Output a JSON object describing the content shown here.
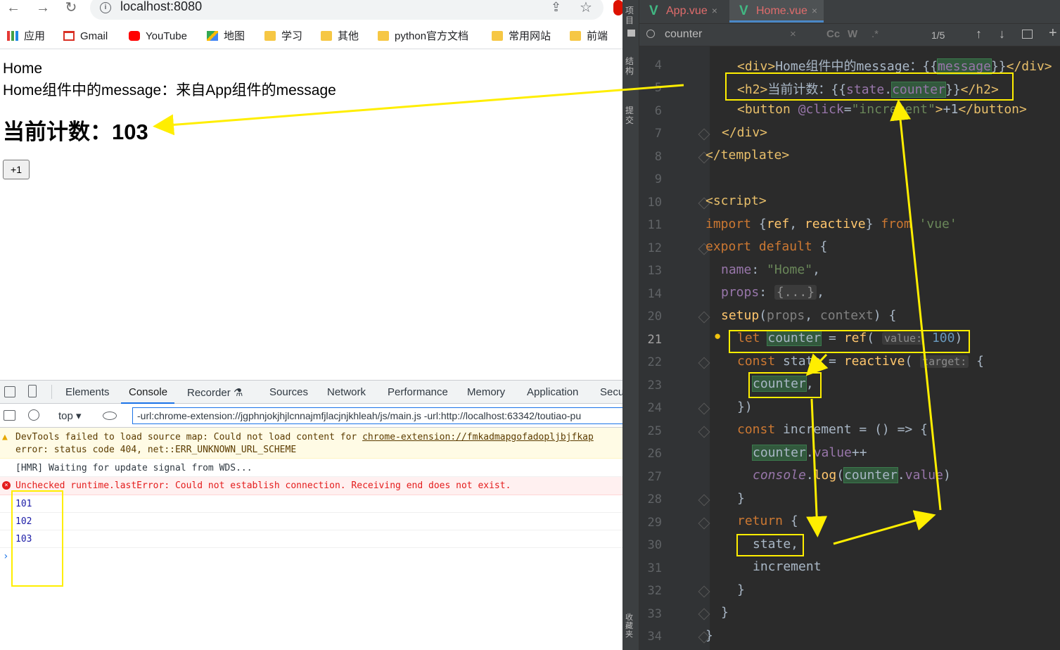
{
  "browser": {
    "url": "localhost:8080",
    "bookmarks": [
      "应用",
      "Gmail",
      "YouTube",
      "地图",
      "学习",
      "其他",
      "python官方文档",
      "常用网站",
      "前端"
    ]
  },
  "page": {
    "title": "Home",
    "message": "Home组件中的message：来自App组件的message",
    "count_label": "当前计数：103",
    "inc_button": "+1"
  },
  "devtools": {
    "tabs": [
      "Elements",
      "Console",
      "Recorder ⚗",
      "Sources",
      "Network",
      "Performance",
      "Memory",
      "Application",
      "Secu"
    ],
    "active_tab": "Console",
    "context": "top ▾",
    "filter": "-url:chrome-extension://jgphnjokjhjlcnnajmfjlacjnjkhleah/js/main.js -url:http://localhost:63342/toutiao-pu",
    "warn_line1": "DevTools failed to load source map: Could not load content for ",
    "warn_link": "chrome-extension://fmkadmapgofadopljbjfkap",
    "warn_line2": "error: status code 404, net::ERR_UNKNOWN_URL_SCHEME",
    "hmr": "[HMR] Waiting for update signal from WDS...",
    "error": "Unchecked runtime.lastError: Could not establish connection. Receiving end does not exist.",
    "logs": [
      "101",
      "102",
      "103"
    ]
  },
  "ide": {
    "tabs": [
      "App.vue",
      "Home.vue"
    ],
    "active_tab": "Home.vue",
    "find": "counter",
    "find_count": "1/5",
    "side_labels": [
      "项目",
      "结构",
      "提交",
      "收藏夹"
    ],
    "line_numbers": [
      "4",
      "5",
      "6",
      "7",
      "8",
      "9",
      "10",
      "11",
      "12",
      "13",
      "14",
      "20",
      "21",
      "22",
      "23",
      "24",
      "25",
      "26",
      "27",
      "28",
      "29",
      "30",
      "31",
      "32",
      "33",
      "34"
    ]
  },
  "colors": {
    "annotation": "#ffee00",
    "vue_green": "#41b883"
  }
}
